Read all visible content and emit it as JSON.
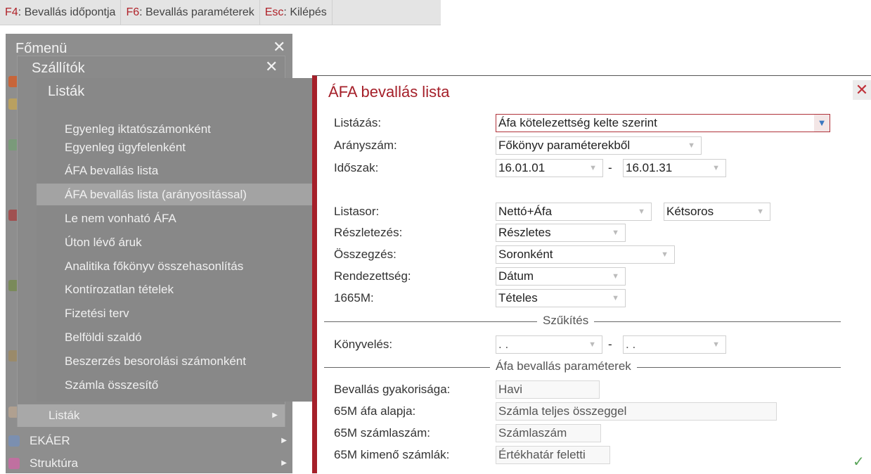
{
  "toolbar": [
    {
      "key": "F4",
      "label": "Bevallás időpontja"
    },
    {
      "key": "F6",
      "label": "Bevallás paraméterek"
    },
    {
      "key": "Esc",
      "label": "Kilépés"
    }
  ],
  "main_menu": {
    "title": "Főmenü",
    "items": [
      "Listák",
      "EKÁER",
      "Struktúra"
    ]
  },
  "suppliers_menu": {
    "title": "Szállítók"
  },
  "lists_menu": {
    "title": "Listák",
    "items": [
      "Egyenleg iktatószámonként",
      "Egyenleg ügyfelenként",
      "ÁFA bevallás lista",
      "ÁFA bevallás lista (arányosítással)",
      "Le nem vonható ÁFA",
      "Úton lévő áruk",
      "Analitika főkönyv összehasonlítás",
      "Kontírozatlan tételek",
      "Fizetési terv",
      "Belföldi szaldó",
      "Beszerzés besorolási számonként",
      "Számla összesítő"
    ],
    "highlighted": "ÁFA bevallás lista (arányosítással)"
  },
  "dialog": {
    "title": "ÁFA bevallás lista",
    "fields": {
      "listazas": {
        "label": "Listázás:",
        "value": "Áfa kötelezettség kelte szerint"
      },
      "aranyszam": {
        "label": "Arányszám:",
        "value": "Főkönyv paraméterekből"
      },
      "idoszak": {
        "label": "Időszak:",
        "from": "16.01.01",
        "to": "16.01.31",
        "sep": "-"
      },
      "listasor": {
        "label": "Listasor:",
        "value": "Nettó+Áfa",
        "value2": "Kétsoros"
      },
      "reszletezes": {
        "label": "Részletezés:",
        "value": "Részletes"
      },
      "osszegzes": {
        "label": "Összegzés:",
        "value": "Soronként"
      },
      "rendezettseg": {
        "label": "Rendezettség:",
        "value": "Dátum"
      },
      "m1665": {
        "label": "1665M:",
        "value": "Tételes"
      },
      "konyveles": {
        "label": "Könyvelés:",
        "from": ". .",
        "to": ". .",
        "sep": "-"
      }
    },
    "section_szukites": "Szűkítés",
    "section_params": "Áfa bevallás paraméterek",
    "params": [
      {
        "label": "Bevallás gyakorisága:",
        "value": "Havi"
      },
      {
        "label": "65M áfa alapja:",
        "value": "Számla teljes összeggel"
      },
      {
        "label": "65M számlaszám:",
        "value": "Számlaszám"
      },
      {
        "label": "65M kimenő számlák:",
        "value": "Értékhatár feletti"
      }
    ],
    "close_symbol": "✕",
    "ok_symbol": "✓"
  }
}
